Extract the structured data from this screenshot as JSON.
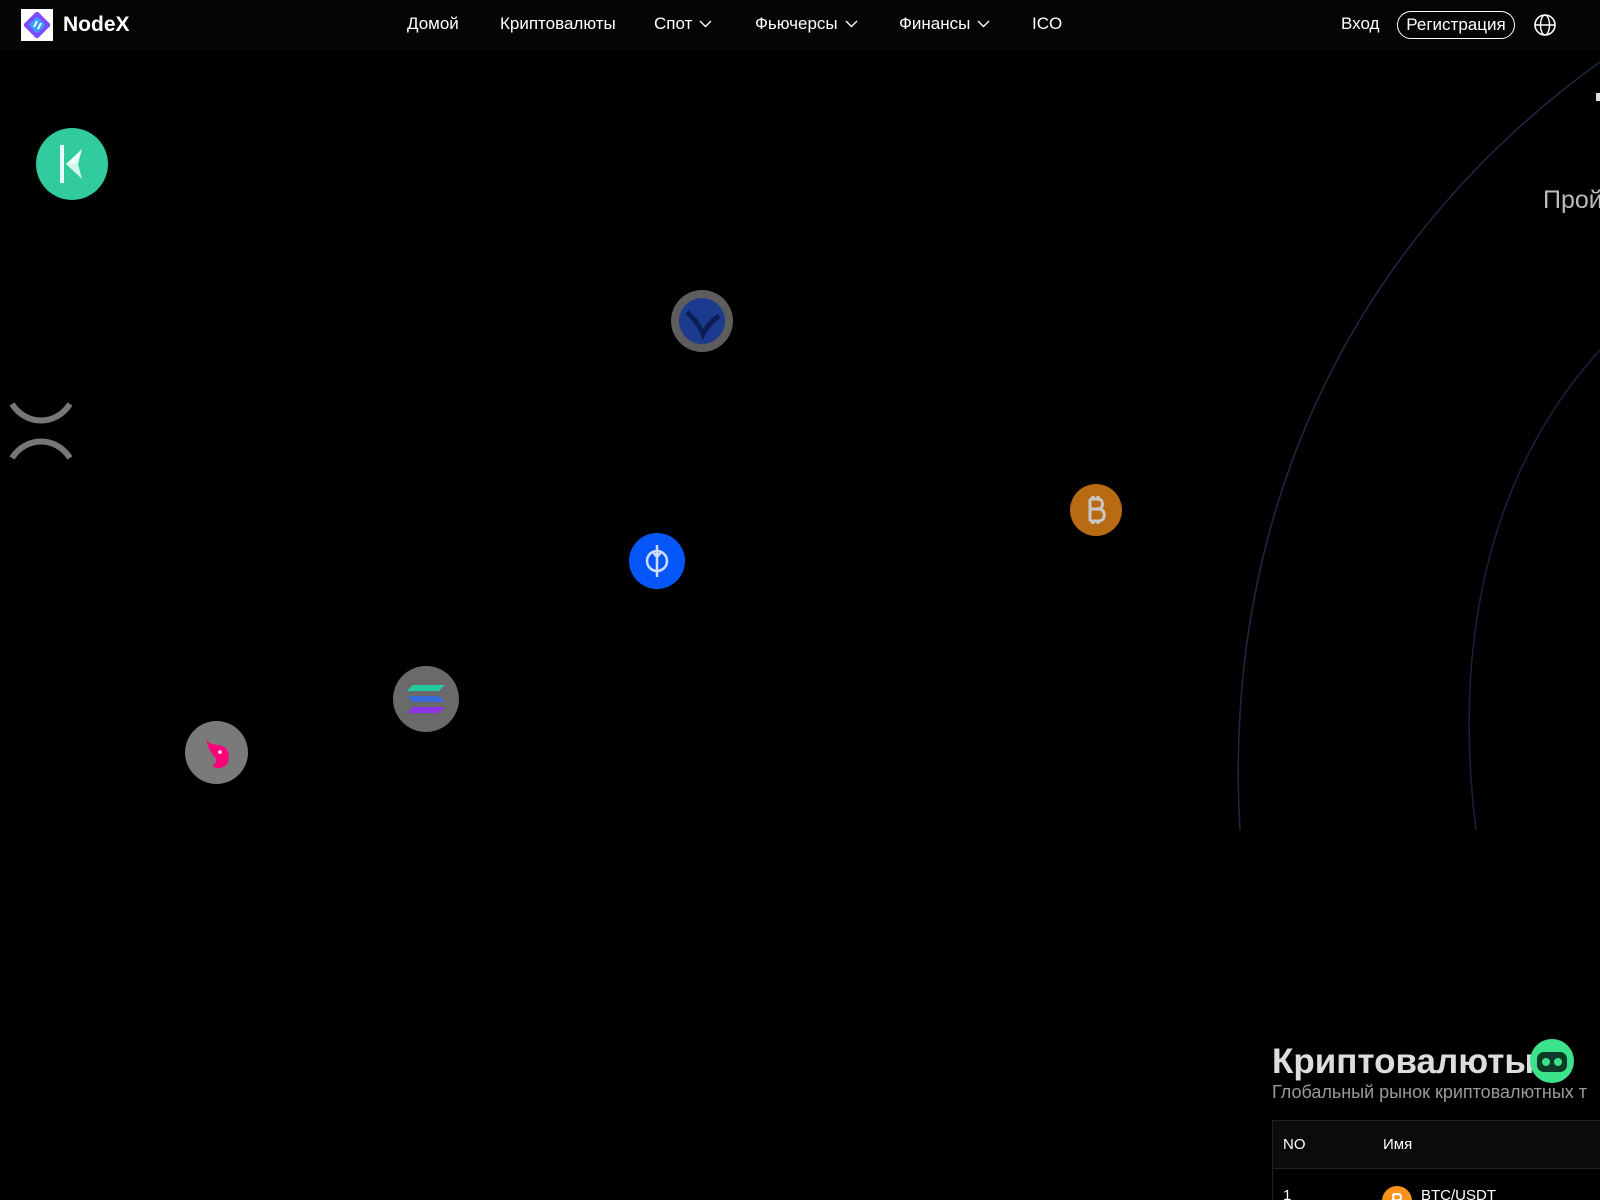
{
  "brand": {
    "name": "NodeX"
  },
  "nav": {
    "home": "Домой",
    "crypto": "Криптовалюты",
    "spot": "Спот",
    "futures": "Фьючерсы",
    "finance": "Финансы",
    "ico": "ICO"
  },
  "auth": {
    "login": "Вход",
    "register": "Регистрация"
  },
  "hero": {
    "partial_text": "Прой"
  },
  "markets": {
    "title": "Криптовалюты",
    "subtitle": "Глобальный рынок криптовалютных т",
    "columns": [
      "NO",
      "Имя"
    ],
    "rows": [
      {
        "no": "1",
        "pair": "BTC/USDT"
      }
    ]
  },
  "colors": {
    "background": "#000000",
    "kyber": "#31cb9e",
    "bitcoin": "#f7931a",
    "yearn": "#0657f9",
    "uniswap": "#ff007a",
    "robot": "#3de38a"
  },
  "icons": [
    "kyber-icon",
    "xrp-icon",
    "terra-icon",
    "yearn-icon",
    "bitcoin-icon",
    "solana-icon",
    "uniswap-icon",
    "globe-icon",
    "robot-icon"
  ]
}
